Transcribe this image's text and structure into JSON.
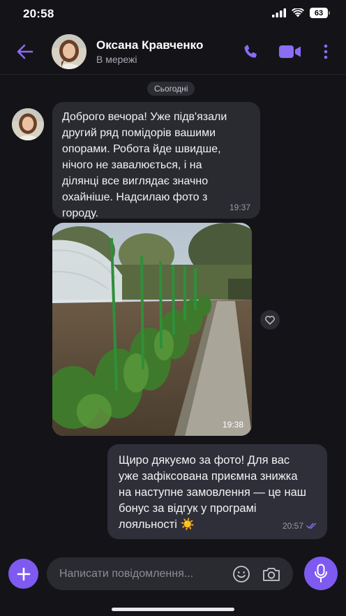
{
  "status_bar": {
    "time": "20:58",
    "battery": "63"
  },
  "header": {
    "contact_name": "Оксана Кравченко",
    "contact_status": "В мережі"
  },
  "chat": {
    "date_divider": "Сьогодні",
    "incoming_message": {
      "text": "Доброго вечора! Уже підв'язали\nдругий ряд помідорів вашими\nопорами. Робота йде швидше,\nнічого не завалюється, і на\nділянці все виглядає значно\nохайніше. Надсилаю фото з\nгороду.",
      "time": "19:37"
    },
    "incoming_photo": {
      "time": "19:38"
    },
    "outgoing_message": {
      "text": "Щиро дякуємо за фото! Для вас\nуже зафіксована приємна знижка\nна наступне замовлення — це наш\nбонус за відгук у програмі\nлояльності ☀️",
      "time": "20:57"
    }
  },
  "composer": {
    "placeholder": "Написати повідомлення..."
  },
  "colors": {
    "accent": "#7f5af0",
    "background": "#141418",
    "incoming_bubble": "#2a2a31",
    "outgoing_bubble": "#2f2f3a"
  },
  "icons": [
    "back-arrow-icon",
    "phone-icon",
    "video-icon",
    "more-icon",
    "heart-icon",
    "plus-icon",
    "emoji-icon",
    "camera-icon",
    "microphone-icon",
    "read-check-icon"
  ]
}
